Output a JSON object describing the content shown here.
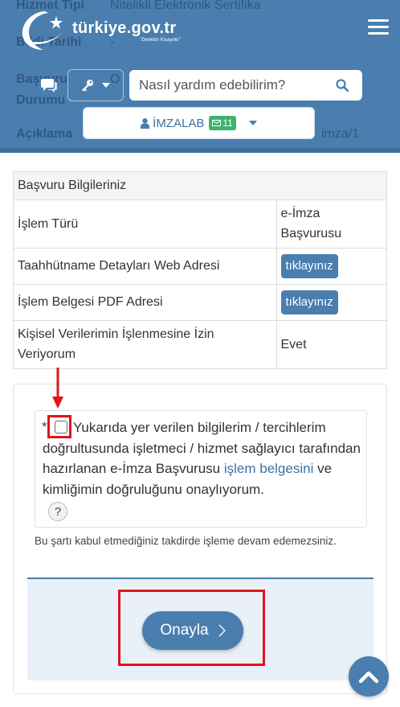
{
  "background_rows": [
    {
      "label": "Hizmet Tipi",
      "value": "Nitelikli Elektronik Sertifika"
    },
    {
      "label": "Bildi Tarihi",
      "value": "-"
    },
    {
      "label": "Başvuru",
      "value": "O"
    },
    {
      "label": "Durumu",
      "value": ""
    },
    {
      "label": "Açıklama",
      "value": "imza/1"
    }
  ],
  "header": {
    "brand": "türkiye.gov.tr",
    "tagline": "\"Devletin Kısayolu\"",
    "search_placeholder": "Nasıl yardım edebilirim?",
    "user_name": "İMZALAB",
    "mail_count": "11"
  },
  "info_panel": {
    "heading": "Başvuru Bilgileriniz",
    "rows": [
      {
        "label": "İşlem Türü",
        "value": "e-İmza Başvurusu"
      },
      {
        "label": "Taahhütname Detayları Web Adresi",
        "button": "tıklayınız"
      },
      {
        "label": "İşlem Belgesi PDF Adresi",
        "button": "tıklayınız"
      },
      {
        "label": "Kişisel Verilerimin İşlenmesine İzin Veriyorum",
        "value": "Evet"
      }
    ]
  },
  "consent": {
    "asterisk": "*",
    "text_before": "Yukarıda yer verilen bilgilerim / tercihlerim doğrultusunda işletmeci / hizmet sağlayıcı tarafından hazırlanan e-İmza Başvurusu ",
    "link_text": "işlem belgesini",
    "text_after": " ve kimliğimin doğruluğunu onaylıyorum.",
    "help_label": "?",
    "warning": "Bu şartı kabul etmediğiniz takdirde işleme devam edemezsiniz."
  },
  "confirm_button": "Onayla",
  "colors": {
    "primary": "#4a7eae",
    "badge_green": "#3cb371",
    "highlight_red": "#e0141e",
    "action_bg": "#eaf0f8"
  }
}
